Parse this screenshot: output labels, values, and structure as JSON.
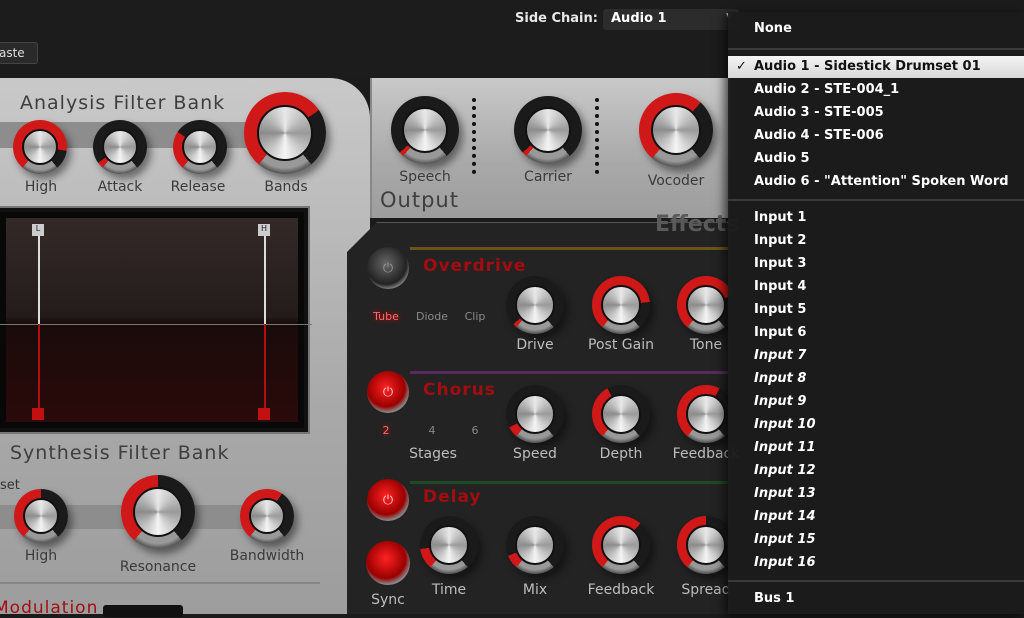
{
  "toolbar": {
    "paste_label": "aste",
    "side_chain_label": "Side Chain:",
    "side_chain_value": "Audio 1"
  },
  "analysis": {
    "title": "Analysis Filter Bank",
    "knobs": [
      {
        "label": "High",
        "value": 0.85
      },
      {
        "label": "Attack",
        "value": 0.05
      },
      {
        "label": "Release",
        "value": 0.3
      },
      {
        "label": "Bands",
        "value": 0.7
      }
    ],
    "display": {
      "low_marker": "L",
      "high_marker": "H"
    }
  },
  "output": {
    "title": "Output",
    "knobs": [
      {
        "label": "Speech",
        "value": 0.03
      },
      {
        "label": "Carrier",
        "value": 0.03
      },
      {
        "label": "Vocoder",
        "value": 0.65
      }
    ]
  },
  "effects": {
    "title": "Effects",
    "overdrive": {
      "title": "Overdrive",
      "enabled": false,
      "modes": [
        "Tube",
        "Diode",
        "Clip"
      ],
      "selected_mode": "Tube",
      "knobs": [
        {
          "label": "Drive",
          "value": 0.03
        },
        {
          "label": "Post Gain",
          "value": 0.8
        },
        {
          "label": "Tone",
          "value": 0.75
        }
      ]
    },
    "chorus": {
      "title": "Chorus",
      "enabled": true,
      "stages": [
        "2",
        "4",
        "6"
      ],
      "selected_stage": "2",
      "stages_label": "Stages",
      "knobs": [
        {
          "label": "Speed",
          "value": 0.08
        },
        {
          "label": "Depth",
          "value": 0.4
        },
        {
          "label": "Feedback",
          "value": 0.6
        }
      ]
    },
    "delay": {
      "title": "Delay",
      "enabled": true,
      "sync_label": "Sync",
      "knobs": [
        {
          "label": "Time",
          "value": 0.15
        },
        {
          "label": "Mix",
          "value": 0.1
        },
        {
          "label": "Feedback",
          "value": 0.65
        },
        {
          "label": "Spread",
          "value": 0.5
        }
      ]
    }
  },
  "synthesis": {
    "title": "Synthesis Filter Bank",
    "partial_label": "set",
    "knobs": [
      {
        "label": "High",
        "value": 0.5
      },
      {
        "label": "Resonance",
        "value": 0.5
      },
      {
        "label": "Bandwidth",
        "value": 0.62
      }
    ]
  },
  "modulation": {
    "title": "Modulation"
  },
  "menu": {
    "items": [
      {
        "label": "None"
      },
      {
        "label": "Audio 1 - Sidestick Drumset 01",
        "checked": true
      },
      {
        "label": "Audio 2 - STE-004_1"
      },
      {
        "label": "Audio 3 - STE-005"
      },
      {
        "label": "Audio 4 - STE-006"
      },
      {
        "label": "Audio 5"
      },
      {
        "label": "Audio 6 - \"Attention\" Spoken Word"
      },
      {
        "label": "Input 1"
      },
      {
        "label": "Input 2"
      },
      {
        "label": "Input 3"
      },
      {
        "label": "Input 4"
      },
      {
        "label": "Input 5"
      },
      {
        "label": "Input 6"
      },
      {
        "label": "Input 7",
        "italic": true
      },
      {
        "label": "Input 8",
        "italic": true
      },
      {
        "label": "Input 9",
        "italic": true
      },
      {
        "label": "Input 10",
        "italic": true
      },
      {
        "label": "Input 11",
        "italic": true
      },
      {
        "label": "Input 12",
        "italic": true
      },
      {
        "label": "Input 13",
        "italic": true
      },
      {
        "label": "Input 14",
        "italic": true
      },
      {
        "label": "Input 15",
        "italic": true
      },
      {
        "label": "Input 16",
        "italic": true
      },
      {
        "label": "Bus 1"
      }
    ],
    "check_glyph": "✓"
  }
}
